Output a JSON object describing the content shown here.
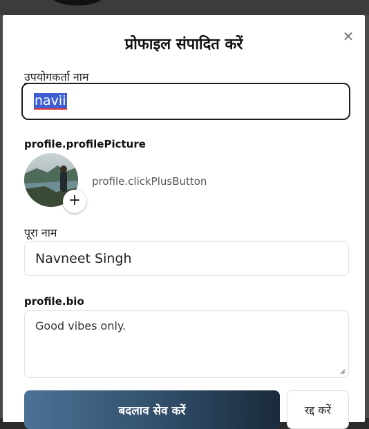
{
  "modal": {
    "title": "प्रोफाइल संपादित करें",
    "close_glyph": "×"
  },
  "username": {
    "label": "उपयोगकर्ता नाम",
    "value": "navii"
  },
  "profile_picture": {
    "label": "profile.profilePicture",
    "hint": "profile.clickPlusButton",
    "plus_glyph": "+"
  },
  "full_name": {
    "label": "पूरा नाम",
    "value": "Navneet Singh"
  },
  "bio": {
    "label": "profile.bio",
    "value": "Good vibes only."
  },
  "actions": {
    "save_label": "बदलाव सेव करें",
    "cancel_label": "रद्द करें"
  },
  "colors": {
    "save_gradient_start": "#4b7297",
    "save_gradient_end": "#1b2b3d",
    "selection": "#3d5fd1"
  },
  "icons": {
    "close": "close-icon",
    "add": "plus-icon"
  }
}
